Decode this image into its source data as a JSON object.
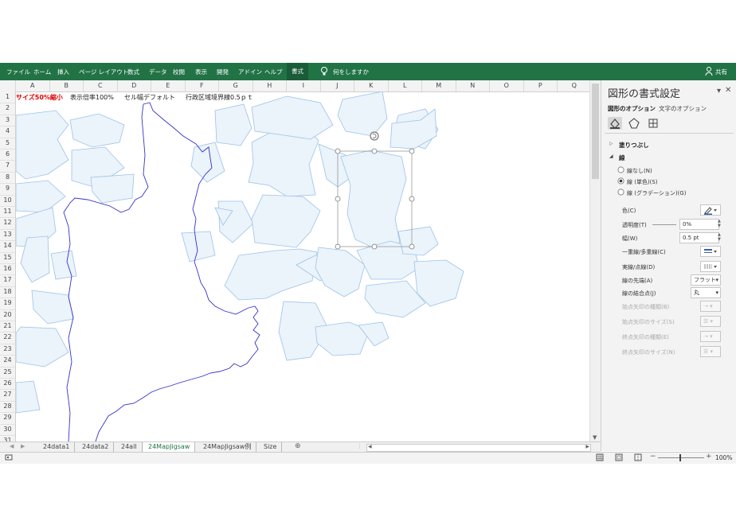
{
  "ribbon": {
    "tabs": [
      "ファイル",
      "ホーム",
      "挿入",
      "ページ レイアウト",
      "数式",
      "データ",
      "校閲",
      "表示",
      "開発",
      "アドイン",
      "ヘルプ"
    ],
    "active_tab": "書式",
    "tell_me": "何をしますか",
    "share": "共有"
  },
  "columns": [
    "A",
    "B",
    "C",
    "D",
    "E",
    "F",
    "G",
    "H",
    "I",
    "J",
    "K",
    "L",
    "M",
    "N",
    "O",
    "P",
    "Q"
  ],
  "rows": [
    "1",
    "2",
    "3",
    "4",
    "5",
    "6",
    "7",
    "8",
    "9",
    "10",
    "11",
    "12",
    "13",
    "14",
    "15",
    "16",
    "17",
    "18",
    "19",
    "20",
    "21",
    "22",
    "23",
    "24",
    "25",
    "26",
    "27",
    "28",
    "29",
    "30",
    "31"
  ],
  "cell_a1": "サイズ50%縮小",
  "cell_b1": "表示倍率100%",
  "cell_e1": "セル幅デフォルト",
  "cell_h1": "行政区域境界線0.5ｐｔ",
  "format_pane": {
    "title": "図形の書式設定",
    "tabs": [
      "図形のオプション",
      "文字のオプション"
    ],
    "icons": [
      "fill-line-icon",
      "effects-icon",
      "size-properties-icon"
    ],
    "section_fill": "塗りつぶし",
    "section_line": "線",
    "radio_options": [
      {
        "label": "線なし(N)",
        "checked": false
      },
      {
        "label": "線 (単色)(S)",
        "checked": true
      },
      {
        "label": "線 (グラデーション)(G)",
        "checked": false
      }
    ],
    "color_label": "色(C)",
    "transparency_label": "透明度(T)",
    "transparency_value": "0%",
    "width_label": "幅(W)",
    "width_value": "0.5 pt",
    "compound_label": "一重線/多重線(C)",
    "dash_label": "実線/点線(D)",
    "cap_label": "線の先端(A)",
    "cap_value": "フラット",
    "join_label": "線の結合点(J)",
    "join_value": "丸",
    "begin_arrow_type_label": "始点矢印の種類(B)",
    "begin_arrow_size_label": "始点矢印のサイズ(S)",
    "end_arrow_type_label": "終点矢印の種類(E)",
    "end_arrow_size_label": "終点矢印のサイズ(N)"
  },
  "sheet_tabs": [
    "24data1",
    "24data2",
    "24all",
    "24MapJigsaw",
    "24MapJigsaw例",
    "Size"
  ],
  "active_sheet": "24MapJigsaw",
  "zoom": "100%",
  "colors": {
    "ribbon": "#217346",
    "region_fill": "#ebf3fb",
    "region_stroke": "#9dc3e6",
    "boundary": "#3333cc",
    "red_text": "#e00000"
  }
}
